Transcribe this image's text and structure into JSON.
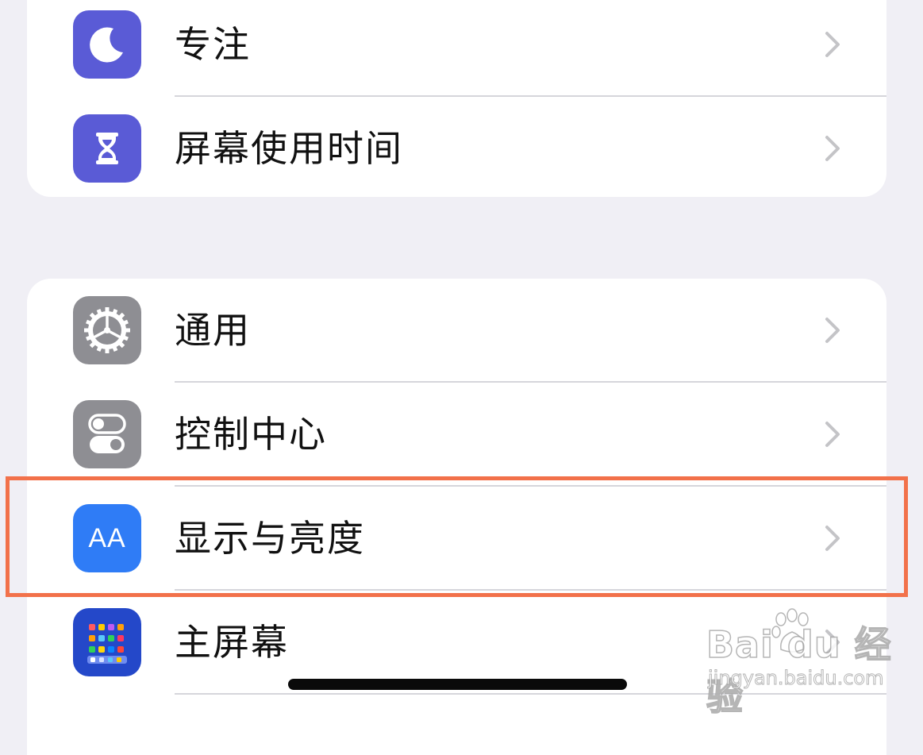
{
  "settings_groups": [
    {
      "items": [
        {
          "label": "专注",
          "icon": "moon-icon",
          "icon_color": "#5a5bd6"
        },
        {
          "label": "屏幕使用时间",
          "icon": "hourglass-icon",
          "icon_color": "#5a5bd6"
        }
      ]
    },
    {
      "items": [
        {
          "label": "通用",
          "icon": "gear-icon",
          "icon_color": "#8e8e93"
        },
        {
          "label": "控制中心",
          "icon": "toggles-icon",
          "icon_color": "#8e8e93"
        },
        {
          "label": "显示与亮度",
          "icon": "text-size-icon",
          "icon_glyph": "AA",
          "icon_color": "#2f7cf6",
          "highlighted": true
        },
        {
          "label": "主屏幕",
          "icon": "home-screen-icon",
          "icon_color": "#2448c9"
        }
      ]
    }
  ],
  "watermark": {
    "logo": "Bai du 经验",
    "url": "jingyan.baidu.com"
  },
  "colors": {
    "background": "#f0eff5",
    "highlight_border": "#f2714a",
    "chevron": "#c4c4c7"
  }
}
